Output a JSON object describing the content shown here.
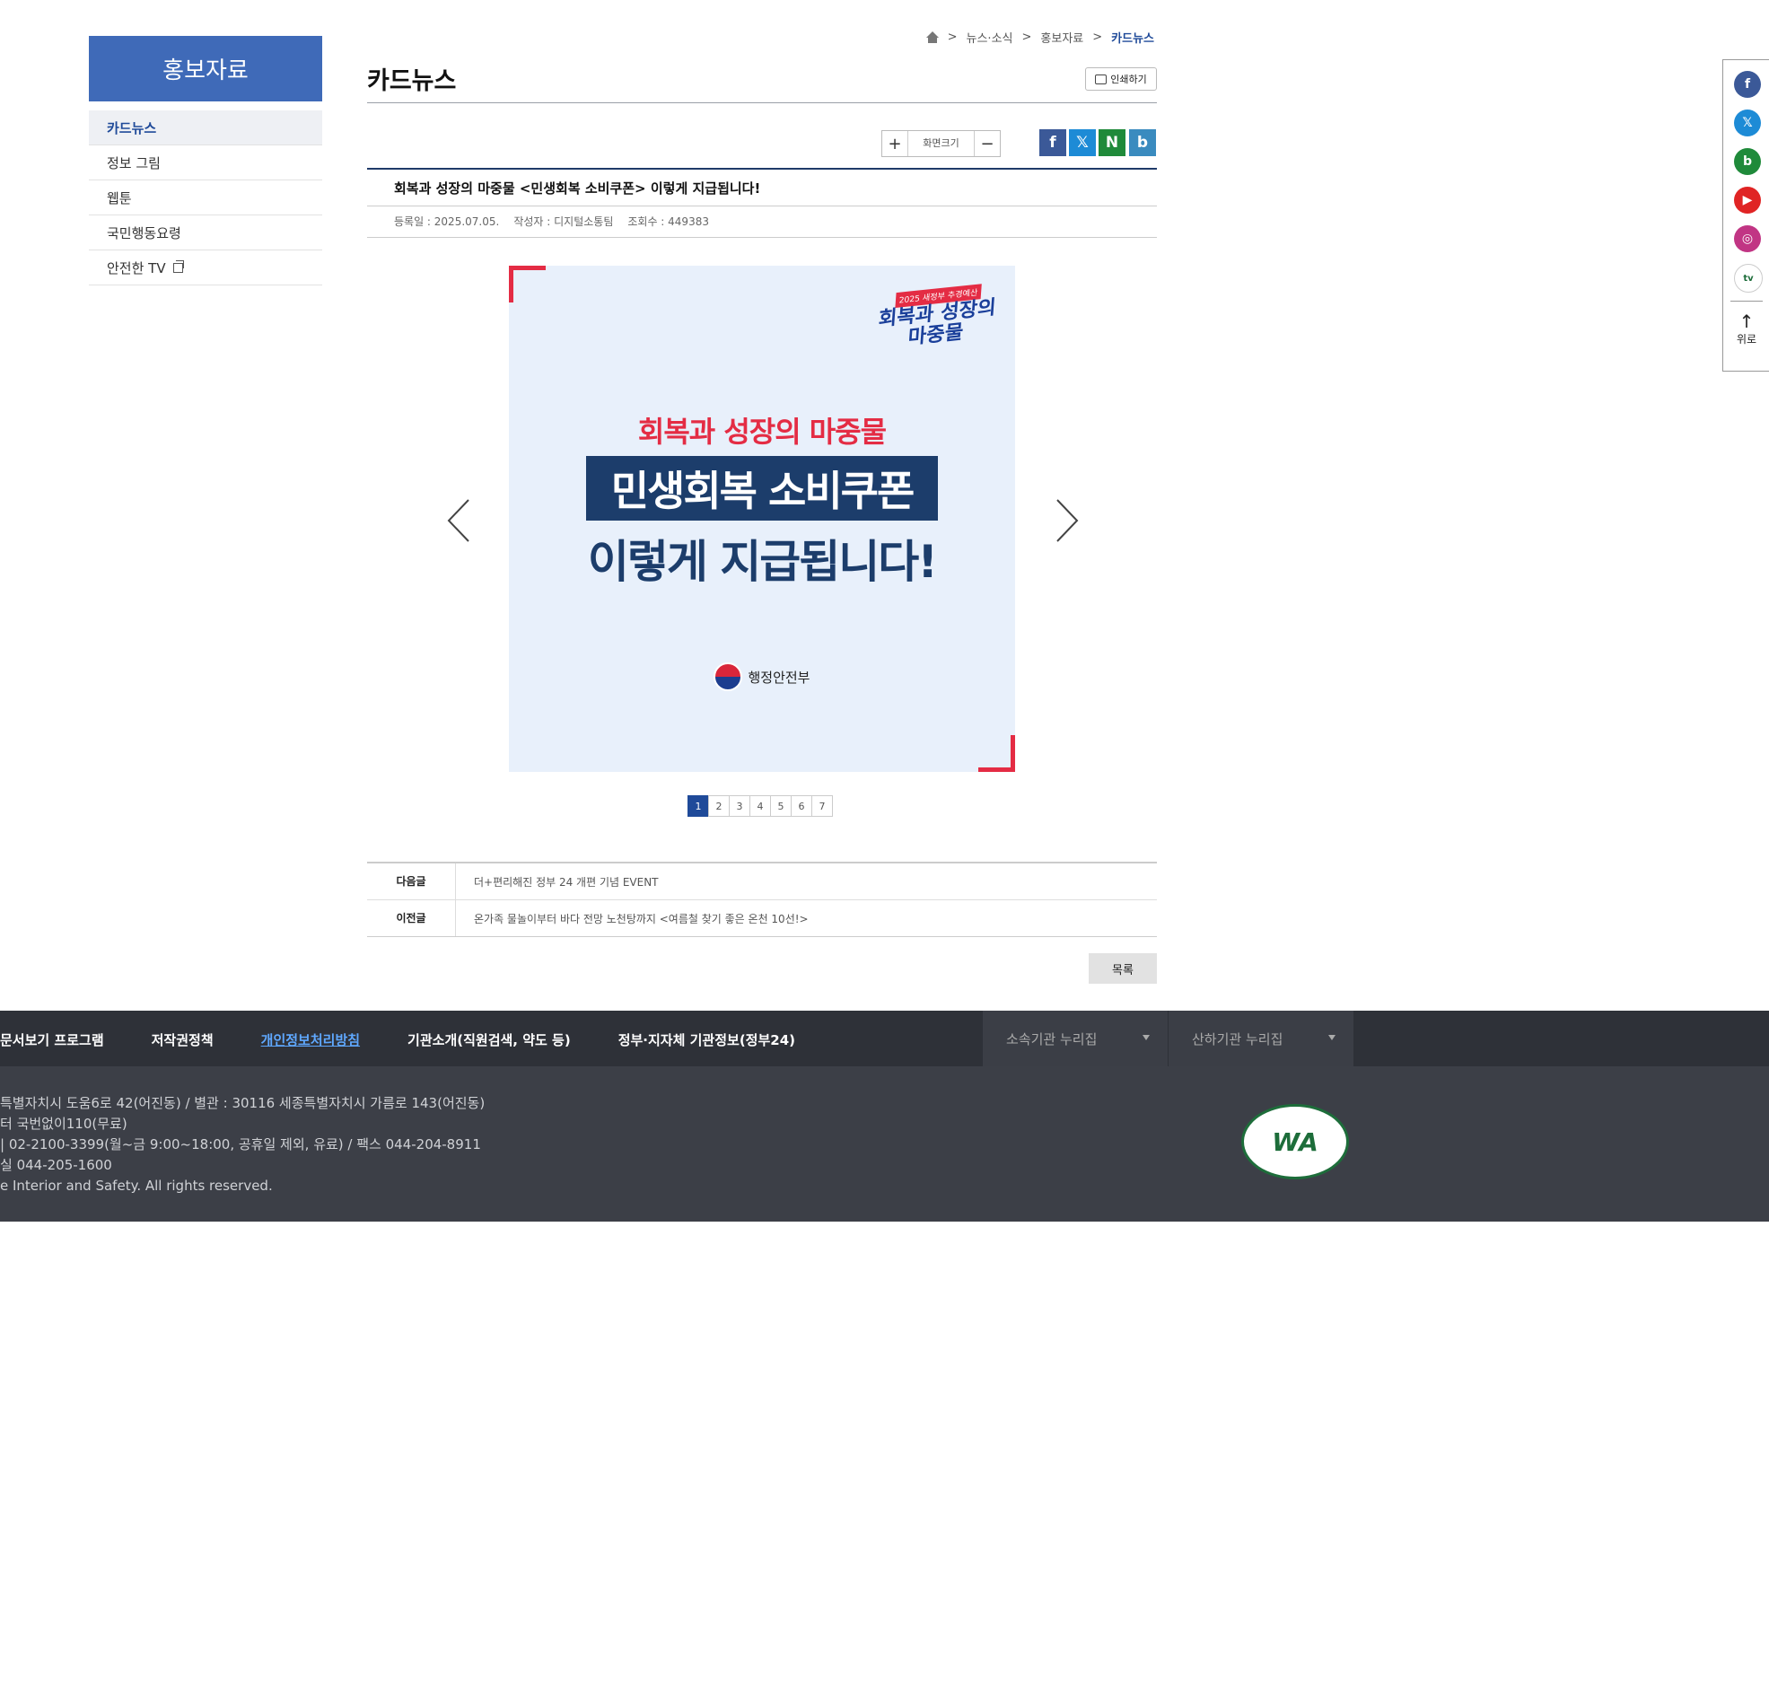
{
  "sidebar": {
    "title": "홍보자료",
    "items": [
      {
        "label": "카드뉴스"
      },
      {
        "label": "정보 그림"
      },
      {
        "label": "웹툰"
      },
      {
        "label": "국민행동요령"
      },
      {
        "label": "안전한 TV"
      }
    ]
  },
  "breadcrumb": [
    "뉴스·소식",
    "홍보자료",
    "카드뉴스"
  ],
  "page": {
    "title": "카드뉴스",
    "print_label": "인쇄하기"
  },
  "zoom": {
    "label": "화면크기"
  },
  "post": {
    "title": "회복과 성장의 마중물 <민생회복 소비쿠폰> 이렇게 지급됩니다!",
    "date": "등록일 : 2025.07.05.",
    "author": "작성자 : 디지털소통팀",
    "views": "조회수 : 449383"
  },
  "card": {
    "badge_top": "2025 새정부 추경예산",
    "badge_main": "회복과 성장의 마중물",
    "subtitle": "회복과 성장의 마중물",
    "headline1": "민생회복 소비쿠폰",
    "headline2": "이렇게 지급됩니다!",
    "org": "행정안전부"
  },
  "pager": [
    "1",
    "2",
    "3",
    "4",
    "5",
    "6",
    "7"
  ],
  "nav": {
    "next_key": "다음글",
    "next_val": "더+편리해진 정부 24 개편 기념 EVENT",
    "prev_key": "이전글",
    "prev_val": "온가족 물놀이부터 바다 전망 노천탕까지 <여름철 찾기 좋은 온천 10선!>"
  },
  "list_button": "목록",
  "footer": {
    "links": [
      "문서보기 프로그램",
      "저작권정책",
      "개인정보처리방침",
      "기관소개(직원검색, 약도 등)",
      "정부·지자체 기관정보(정부24)"
    ],
    "select1": "소속기관 누리집",
    "select2": "산하기관 누리집",
    "addr1": "특별자치시 도움6로 42(어진동) / 별관 : 30116 세종특별자치시 가름로 143(어진동)",
    "addr2": "터 국번없이110(무료)",
    "addr3": "| 02-2100-3399(월~금 9:00~18:00, 공휴일 제외, 유료) / 팩스 044-204-8911",
    "addr4": "실 044-205-1600",
    "copy": "e Interior and Safety. All rights reserved.",
    "wa": "WA"
  },
  "rail": {
    "up_label": "위로"
  },
  "colors": {
    "accent": "#1f4a99",
    "sidebar": "#3f6ab8",
    "card_red": "#e42c44",
    "card_navy": "#1c3d6b",
    "footer": "#3c3f47"
  }
}
